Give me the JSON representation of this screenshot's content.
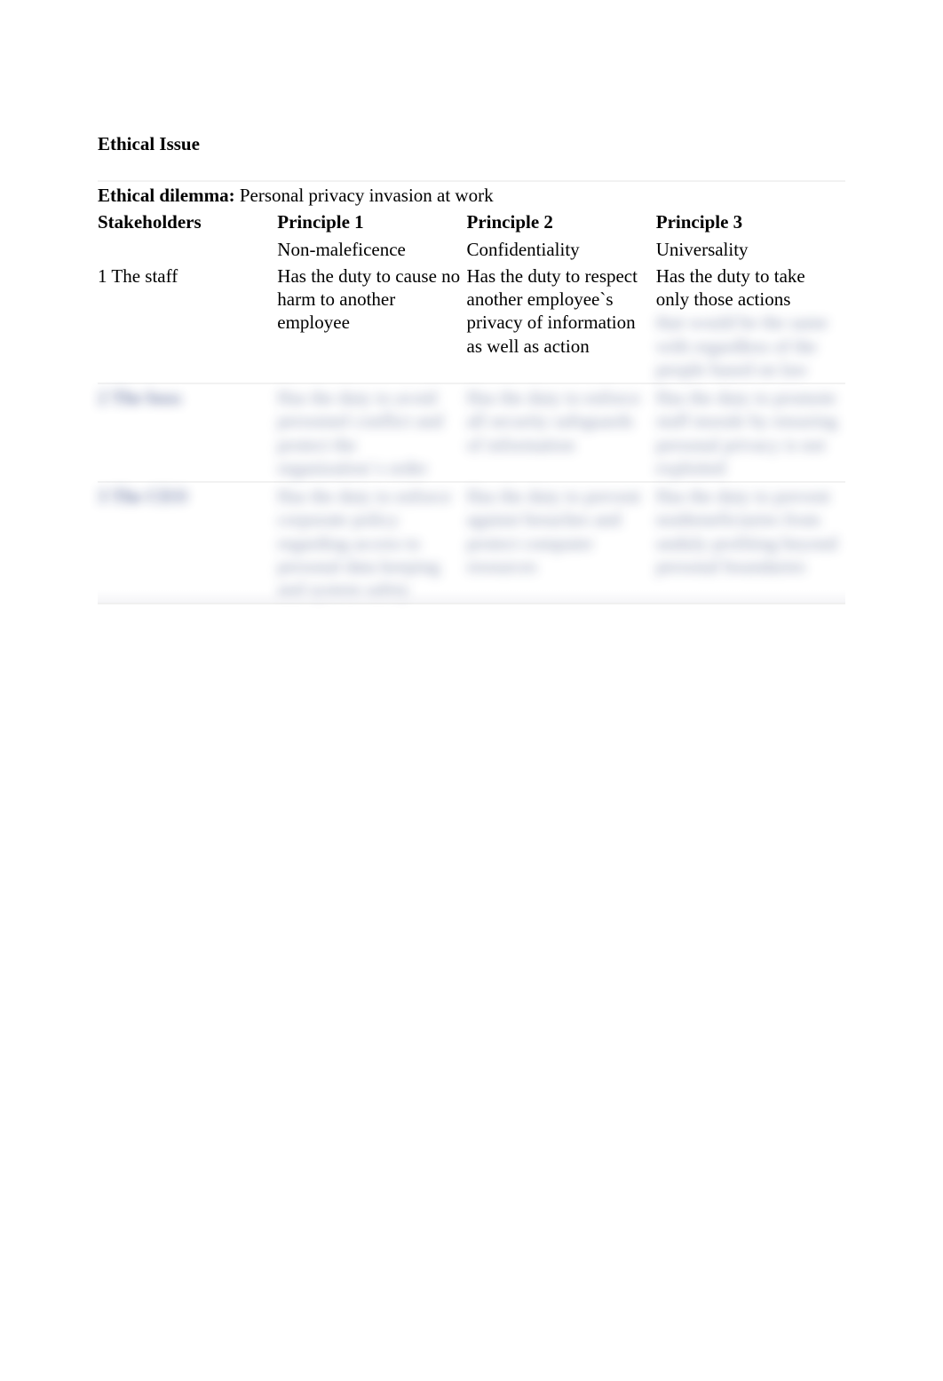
{
  "section_title": "Ethical Issue",
  "dilemma": {
    "label": "Ethical dilemma:",
    "text": "Personal privacy invasion at work"
  },
  "headers": {
    "stakeholders": "Stakeholders",
    "p1": "Principle 1",
    "p2": "Principle 2",
    "p3": "Principle 3"
  },
  "subheaders": {
    "p1": "Non-maleficence",
    "p2": "Confidentiality",
    "p3": "Universality"
  },
  "rows": [
    {
      "stakeholder": "1 The staff",
      "p1": "Has the duty to cause no harm to another employee",
      "p2": "Has the duty to respect another employee`s privacy of information as well as action",
      "p3_clear": "Has the duty to take only those actions",
      "p3_obscured": "that would be the same with regardless of the people based on law"
    },
    {
      "stakeholder_obscured": "2 The boss",
      "p1_obscured": "Has the duty to avoid personnel conflict and protect the organization`s order",
      "p2_obscured": "Has the duty to enforce all security safeguards of information",
      "p3_obscured": "Has the duty to promote staff morale by ensuring personal privacy is not exploited"
    },
    {
      "stakeholder_obscured": "3 The CEO",
      "p1_obscured": "Has the duty to enforce corporate policy regarding access to personal data keeping and system safety",
      "p2_obscured": "Has the duty to prevent against breaches and protect computer resources",
      "p3_obscured": "Has the duty to prevent nonbeneficiaries from unduly profiting beyond personal boundaries"
    }
  ]
}
